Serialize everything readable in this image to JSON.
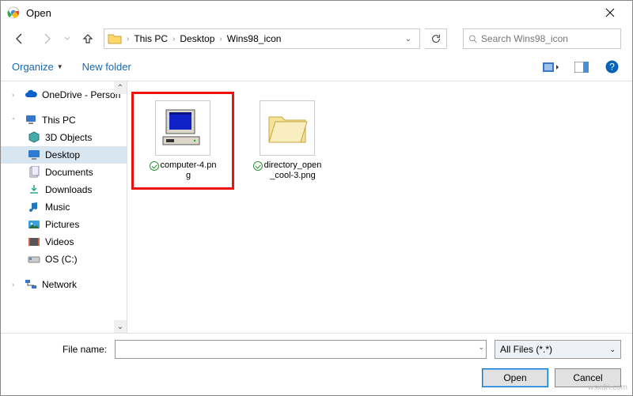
{
  "window": {
    "title": "Open"
  },
  "breadcrumb": {
    "parts": [
      "This PC",
      "Desktop",
      "Wins98_icon"
    ]
  },
  "search": {
    "placeholder": "Search Wins98_icon"
  },
  "toolbar": {
    "organize": "Organize",
    "newfolder": "New folder"
  },
  "tree": {
    "onedrive": "OneDrive - Person",
    "thispc": "This PC",
    "items": [
      "3D Objects",
      "Desktop",
      "Documents",
      "Downloads",
      "Music",
      "Pictures",
      "Videos",
      "OS (C:)"
    ],
    "network": "Network"
  },
  "files": [
    {
      "name": "computer-4.png",
      "display": "computer-4.pn\ng",
      "kind": "computer"
    },
    {
      "name": "directory_open_cool-3.png",
      "display": "directory_open\n_cool-3.png",
      "kind": "folder"
    }
  ],
  "footer": {
    "fnlabel": "File name:",
    "fnvalue": "",
    "filter": "All Files (*.*)",
    "open": "Open",
    "cancel": "Cancel"
  },
  "watermark": "wsxdn.com"
}
